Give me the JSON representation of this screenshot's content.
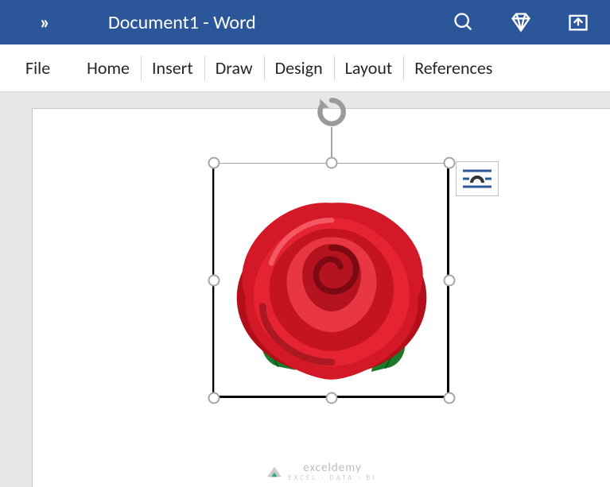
{
  "titlebar": {
    "document_title": "Document1  -  Word"
  },
  "ribbon": {
    "tabs": {
      "file": "File",
      "home": "Home",
      "insert": "Insert",
      "draw": "Draw",
      "design": "Design",
      "layout": "Layout",
      "references": "References"
    }
  },
  "selected_object": {
    "alt_text": "Red rose",
    "layout_options_tooltip": "Layout Options"
  },
  "watermark": {
    "brand": "exceldemy",
    "tagline": "EXCEL · DATA · BI"
  }
}
